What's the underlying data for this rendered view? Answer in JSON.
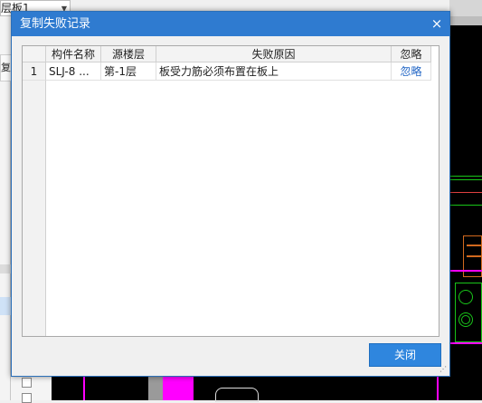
{
  "background": {
    "floor_combo_text": "层板1",
    "side_button_text": "复制"
  },
  "dialog": {
    "title": "复制失败记录",
    "close_glyph": "×",
    "columns": [
      "构件名称",
      "源楼层",
      "失败原因",
      "忽略"
    ],
    "rows": [
      {
        "index": "1",
        "component_name": "SLJ-8 ...",
        "source_floor": "第-1层",
        "reason": "板受力筋必须布置在板上",
        "ignore_label": "忽略"
      }
    ],
    "close_button_label": "关闭"
  }
}
